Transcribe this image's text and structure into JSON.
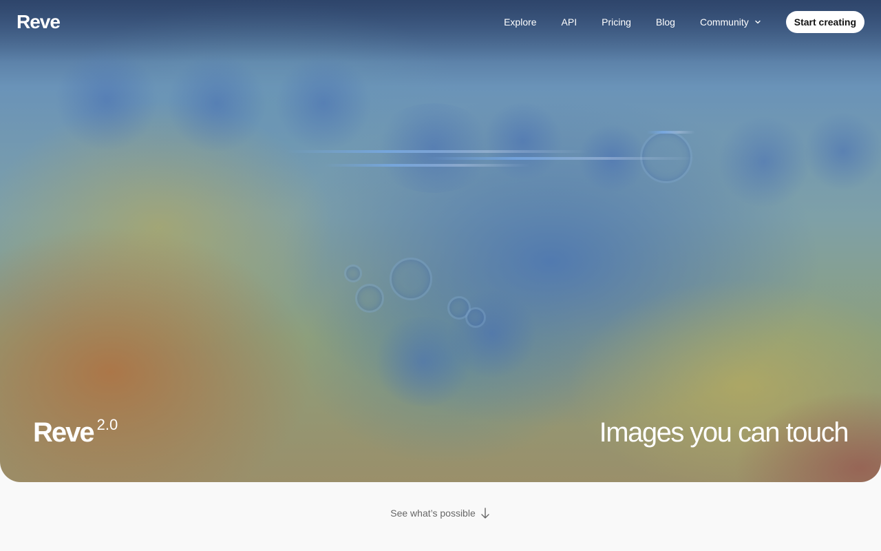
{
  "header": {
    "logo": "Reve",
    "nav": [
      {
        "label": "Explore"
      },
      {
        "label": "API"
      },
      {
        "label": "Pricing"
      },
      {
        "label": "Blog"
      },
      {
        "label": "Community",
        "has_dropdown": true
      }
    ],
    "cta_label": "Start creating"
  },
  "hero": {
    "brand_name": "Reve",
    "brand_version": "2.0",
    "tagline": "Images you can touch"
  },
  "footer": {
    "see_more_label": "See what’s possible",
    "see_more_icon": "arrow-down-icon"
  },
  "colors": {
    "page_background": "#f9f9f9",
    "cta_background": "#ffffff",
    "text_on_hero": "#ffffff",
    "muted_text": "#666666"
  }
}
